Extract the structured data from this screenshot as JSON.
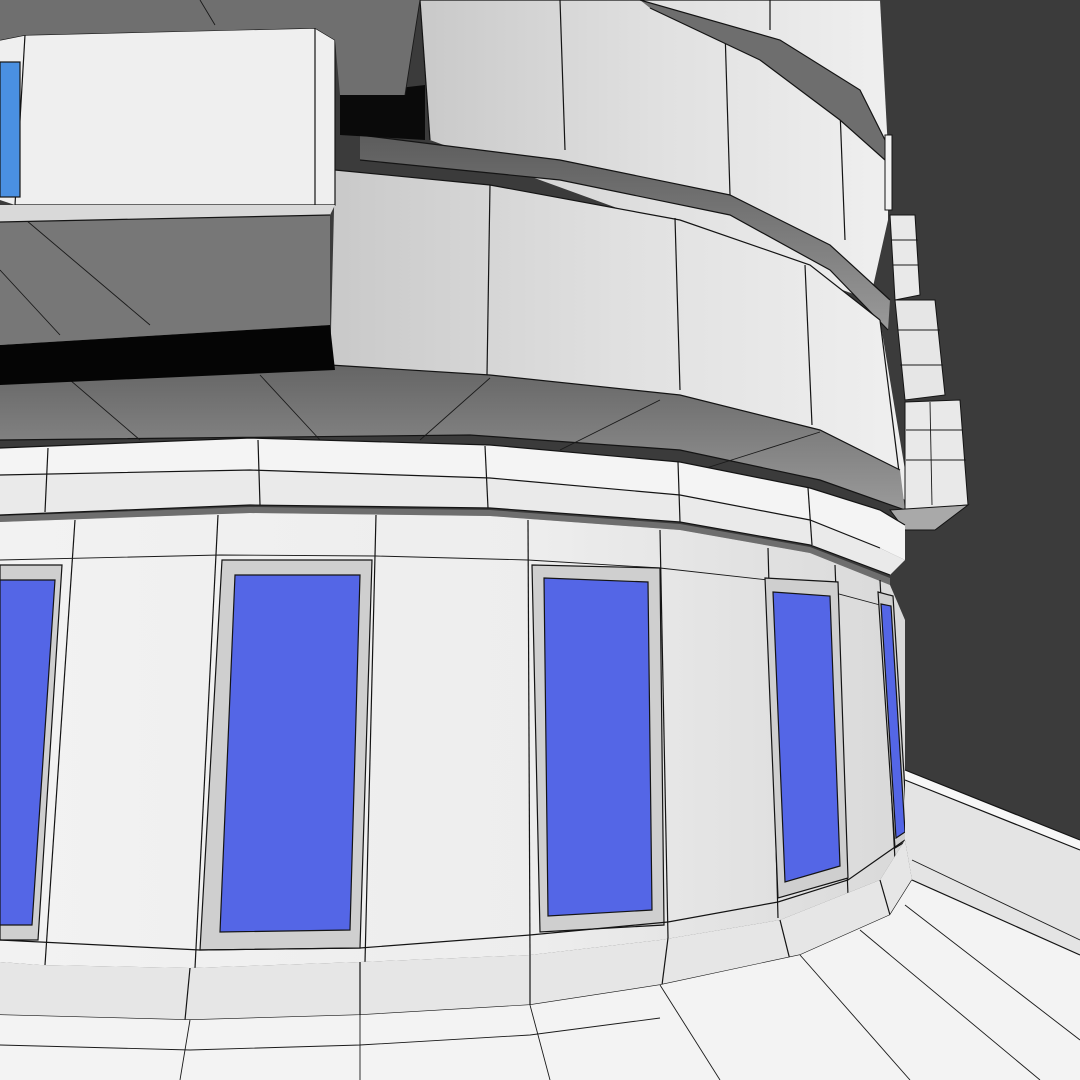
{
  "scene": {
    "kind": "3d-model-viewport-render",
    "subject": "curved-building-with-windows",
    "render_mode": "shaded-with-wireframe-edges",
    "colors": {
      "background": "#3b3b3b",
      "wall": "#ececec",
      "wall_shadow": "#8a8a8a",
      "ledge": "#7a7a7a",
      "window_glass": "#5466e6",
      "window_glass_light": "#4a90e2",
      "window_frame": "#cfcfcf",
      "edge": "#141414",
      "shadow": "#000000"
    },
    "counts": {
      "visible_ground_floor_windows": 5,
      "visible_upper_balcony_window": 1,
      "floor_bands": 3
    }
  }
}
